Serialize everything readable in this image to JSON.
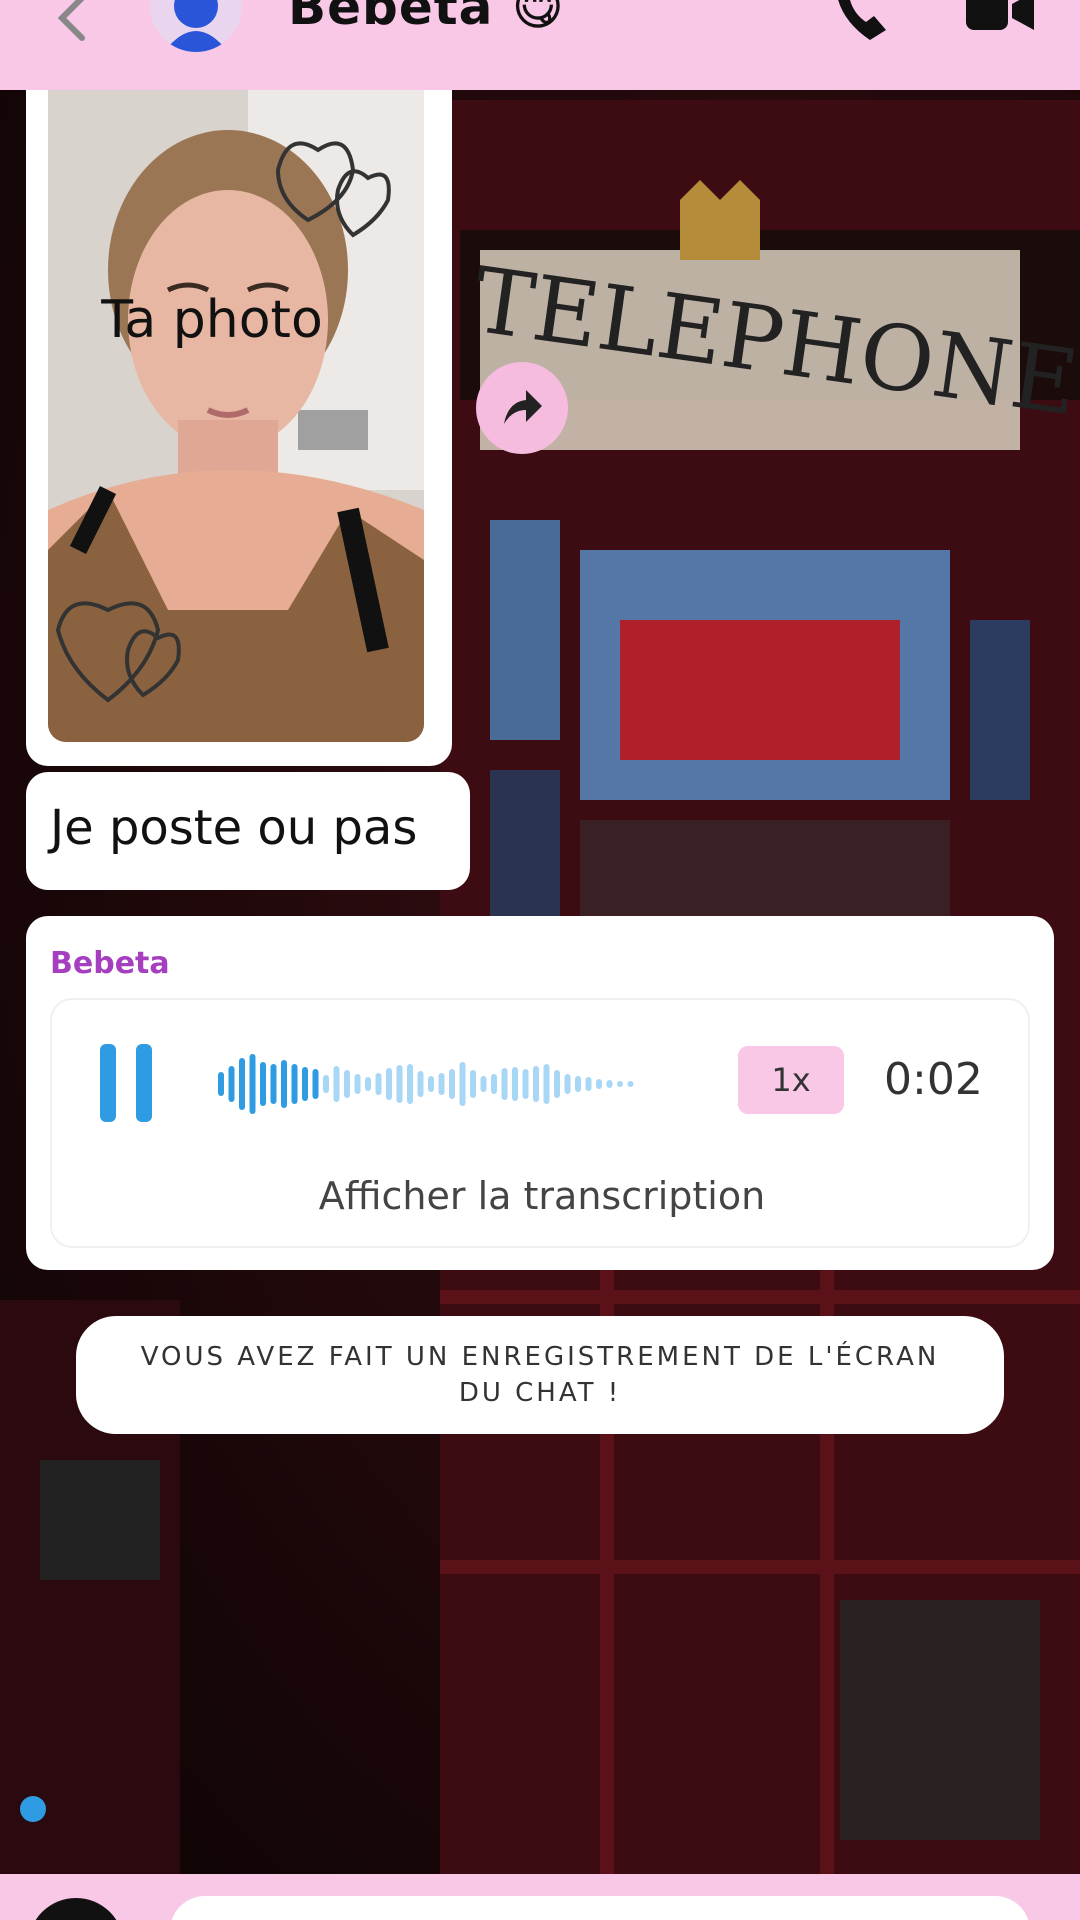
{
  "header": {
    "contact_name": "Bebeta 😋"
  },
  "icons": {
    "back": "chevron-left-icon",
    "avatar": "user-avatar-icon",
    "call": "phone-icon",
    "video": "video-camera-icon",
    "share": "share-arrow-icon",
    "pause": "pause-icon"
  },
  "messages": {
    "photo_caption": "Ta photo",
    "text": "Je poste ou pas"
  },
  "voice_note": {
    "sender": "Bebeta",
    "speed": "1x",
    "duration": "0:02",
    "transcript_label": "Afficher la transcription"
  },
  "notice": {
    "text": "VOUS AVEZ FAIT UN ENREGISTREMENT DE L'ÉCRAN DU CHAT !"
  },
  "colors": {
    "header_bg": "#f8c8e6",
    "accent_blue": "#2f9be2",
    "sender_purple": "#a53fbf"
  }
}
